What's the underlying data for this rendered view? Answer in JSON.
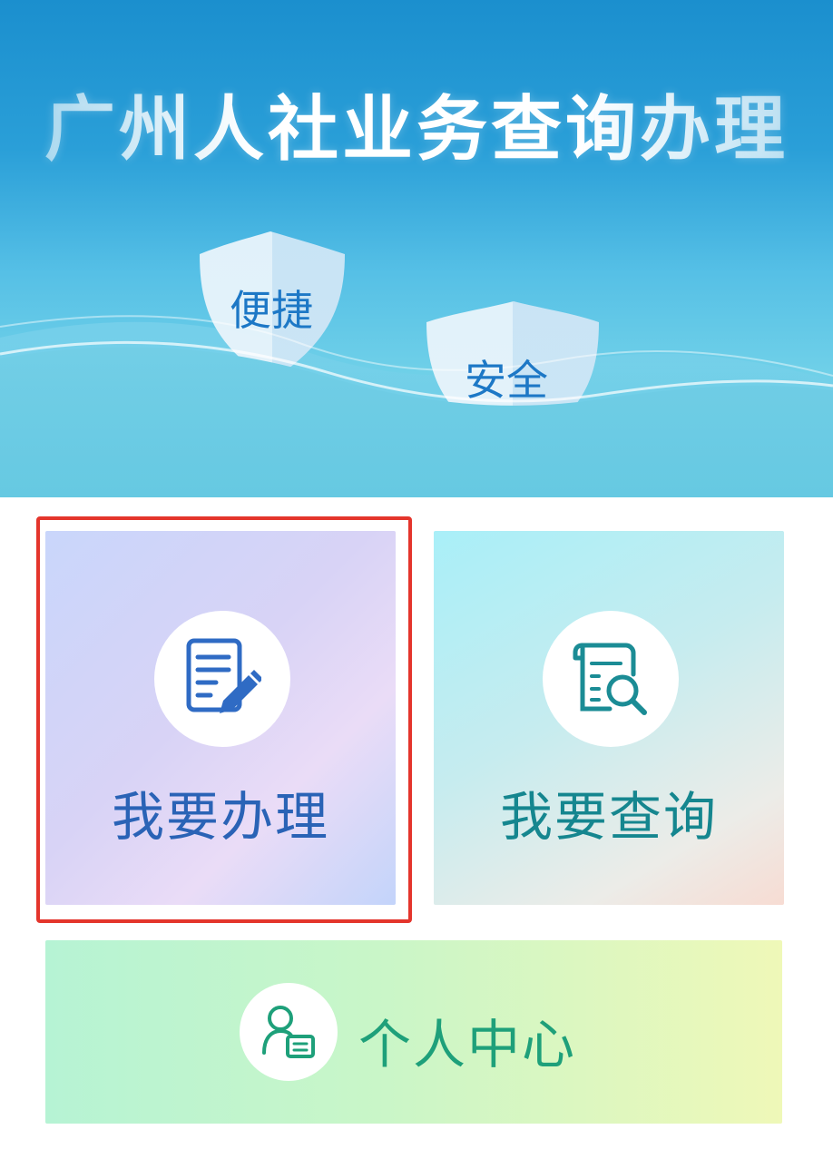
{
  "banner": {
    "title": "广州人社业务查询办理",
    "shield_left": "便捷",
    "shield_right": "安全"
  },
  "cards": {
    "handle": {
      "label": "我要办理",
      "icon": "document-edit-icon"
    },
    "query": {
      "label": "我要查询",
      "icon": "document-search-icon"
    },
    "personal": {
      "label": "个人中心",
      "icon": "user-card-icon"
    }
  },
  "colors": {
    "highlight": "#e4352c",
    "handle_text": "#2a63b6",
    "query_text": "#15868f",
    "personal_text": "#1ea07a"
  }
}
